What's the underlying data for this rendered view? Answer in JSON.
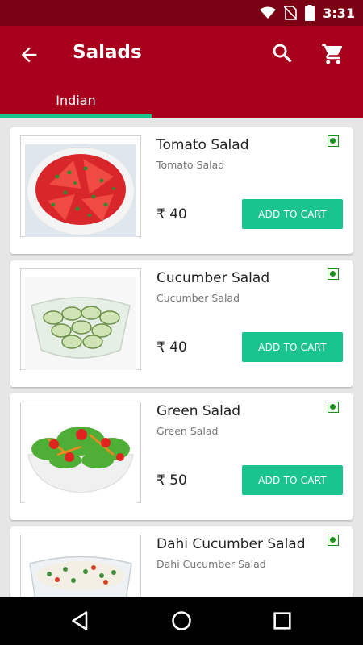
{
  "status_bar": {
    "time": "3:31",
    "icons": [
      "wifi-icon",
      "no-sim-icon",
      "battery-icon"
    ]
  },
  "app_bar": {
    "title": "Salads",
    "icons": [
      "back-arrow-icon",
      "search-icon",
      "cart-icon"
    ]
  },
  "tabs": [
    {
      "label": "Indian",
      "selected": true
    }
  ],
  "products": [
    {
      "name": "Tomato Salad",
      "subtitle": "Tomato Salad",
      "price": "₹ 40",
      "button": "ADD TO CART",
      "veg": true
    },
    {
      "name": "Cucumber Salad",
      "subtitle": "Cucumber Salad",
      "price": "₹ 40",
      "button": "ADD TO CART",
      "veg": true
    },
    {
      "name": "Green Salad",
      "subtitle": "Green Salad",
      "price": "₹ 50",
      "button": "ADD TO CART",
      "veg": true
    },
    {
      "name": "Dahi Cucumber Salad",
      "subtitle": "Dahi Cucumber Salad",
      "price": "",
      "button": "",
      "veg": true
    }
  ],
  "nav_bar": {
    "icons": [
      "back-triangle-icon",
      "home-circle-icon",
      "recents-square-icon"
    ]
  },
  "colors": {
    "app_bar": "#a8001c",
    "status_bar": "#7a0014",
    "accent": "#19c48f",
    "veg_mark": "#1a8f1a"
  }
}
